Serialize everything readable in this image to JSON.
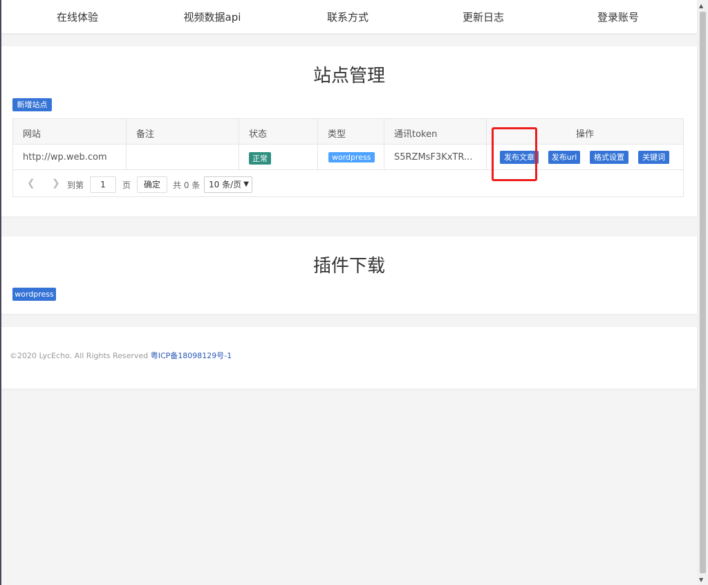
{
  "nav": {
    "items": [
      {
        "label": "在线体验"
      },
      {
        "label": "视频数据api"
      },
      {
        "label": "联系方式"
      },
      {
        "label": "更新日志"
      },
      {
        "label": "登录账号"
      }
    ]
  },
  "sites": {
    "title": "站点管理",
    "add_button": "新增站点",
    "columns": [
      "网站",
      "备注",
      "状态",
      "类型",
      "通讯token",
      "操作"
    ],
    "rows": [
      {
        "website": "http://wp.web.com",
        "note": "",
        "status": "正常",
        "type": "wordpress",
        "token": "S5RZMsF3KxTR...",
        "actions": [
          "发布文章",
          "发布url",
          "格式设置",
          "关键词"
        ]
      }
    ],
    "pager": {
      "goto_label": "到第",
      "page_value": "1",
      "page_unit": "页",
      "confirm": "确定",
      "total": "共 0 条",
      "page_size": "10 条/页"
    }
  },
  "plugins": {
    "title": "插件下载",
    "download_button": "wordpress"
  },
  "footer": {
    "copyright": "©2020 LycEcho. All Rights Reserved",
    "icp": "粤ICP备18098129号-1"
  },
  "colors": {
    "primary": "#3574d6",
    "status_ok": "#2f8f80",
    "type_tag": "#4da3ff",
    "highlight": "#ee1c1c"
  }
}
